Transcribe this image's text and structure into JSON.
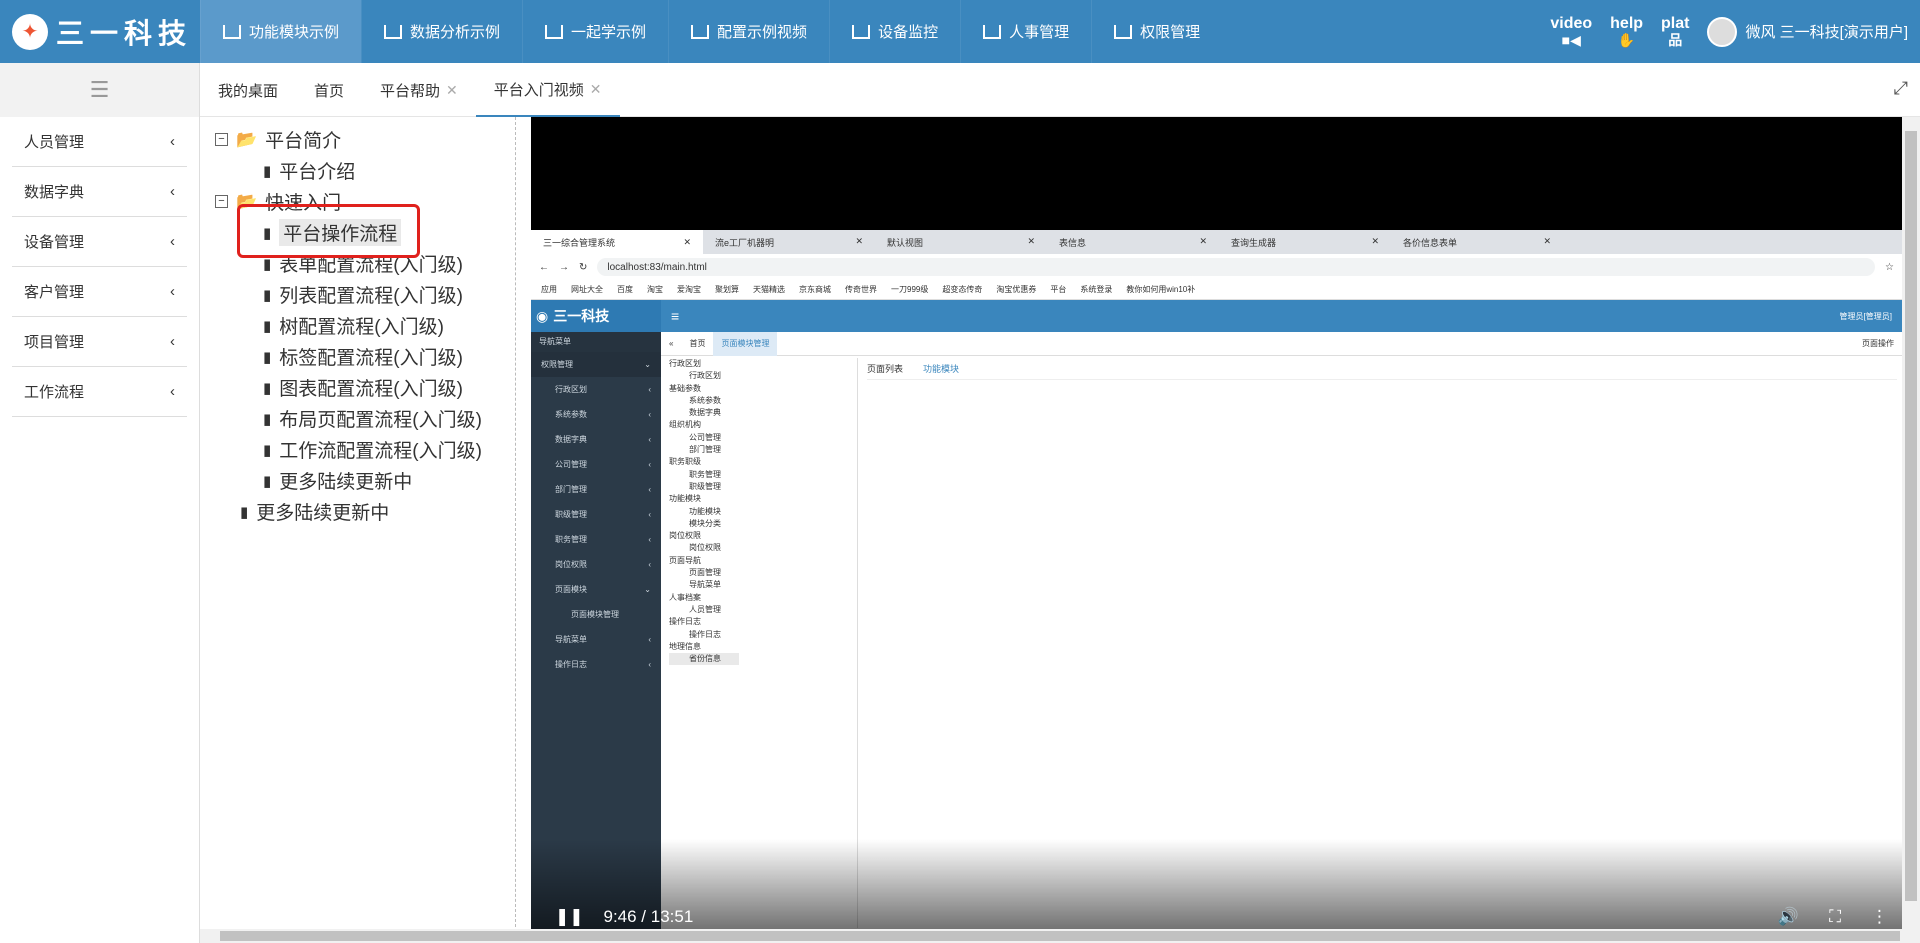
{
  "brand": {
    "logo_text": "三一科技",
    "accent": "#3a86bd",
    "topbar_active": "#5b9acb"
  },
  "nav": [
    {
      "label": "功能模块示例",
      "active": true
    },
    {
      "label": "数据分析示例"
    },
    {
      "label": "一起学示例"
    },
    {
      "label": "配置示例视频"
    },
    {
      "label": "设备监控"
    },
    {
      "label": "人事管理"
    },
    {
      "label": "权限管理"
    }
  ],
  "tools": {
    "video": "video",
    "help": "help",
    "plat": "plat"
  },
  "user": {
    "name": "微风 三一科技[演示用户]"
  },
  "tabs": [
    {
      "label": "我的桌面"
    },
    {
      "label": "首页"
    },
    {
      "label": "平台帮助",
      "closable": true
    },
    {
      "label": "平台入门视频",
      "closable": true,
      "active": true
    }
  ],
  "sidebar": [
    {
      "label": "人员管理"
    },
    {
      "label": "数据字典"
    },
    {
      "label": "设备管理"
    },
    {
      "label": "客户管理"
    },
    {
      "label": "项目管理"
    },
    {
      "label": "工作流程"
    }
  ],
  "tree": {
    "n0": "平台简介",
    "n1": "平台介绍",
    "n2": "快速入门",
    "n3": "平台操作流程",
    "n4": "表单配置流程(入门级)",
    "n5": "列表配置流程(入门级)",
    "n6": "树配置流程(入门级)",
    "n7": "标签配置流程(入门级)",
    "n8": "图表配置流程(入门级)",
    "n9": "布局页配置流程(入门级)",
    "n10": "工作流配置流程(入门级)",
    "n11": "更多陆续更新中",
    "n12": "更多陆续更新中"
  },
  "video": {
    "time": "9:46 / 13:51",
    "browser_tabs": [
      "三一综合管理系统",
      "流e工厂机器明",
      "默认视图",
      "表信息",
      "查询生成器",
      "各价信息表单"
    ],
    "url": "localhost:83/main.html",
    "bookmarks": [
      "应用",
      "网址大全",
      "百度",
      "淘宝",
      "爱淘宝",
      "聚划算",
      "天猫精选",
      "京东商城",
      "传奇世界",
      "一刀999级",
      "超变态传奇",
      "淘宝优惠券",
      "平台",
      "系统登录",
      "教你如何用win10补"
    ],
    "app_title": "三一科技",
    "app_user": "管理员[管理员]",
    "nav_header": "导航菜单",
    "app_menu": [
      "权限管理",
      "行政区划",
      "系统参数",
      "数据字典",
      "公司管理",
      "部门管理",
      "职级管理",
      "职务管理",
      "岗位权限",
      "页面模块",
      "页面模块管理",
      "导航菜单",
      "操作日志"
    ],
    "app_tabs": [
      "首页",
      "页面模块管理",
      "页面操作"
    ],
    "mini_tree": [
      "行政区划",
      "行政区划",
      "基础参数",
      "系统参数",
      "数据字典",
      "组织机构",
      "公司管理",
      "部门管理",
      "职务职级",
      "职务管理",
      "职级管理",
      "功能模块",
      "功能模块",
      "模块分类",
      "岗位权限",
      "岗位权限",
      "页面导航",
      "页面管理",
      "导航菜单",
      "人事档案",
      "人员管理",
      "操作日志",
      "操作日志",
      "地理信息",
      "省份信息"
    ],
    "right_tabs": [
      "页面列表",
      "功能模块"
    ]
  }
}
